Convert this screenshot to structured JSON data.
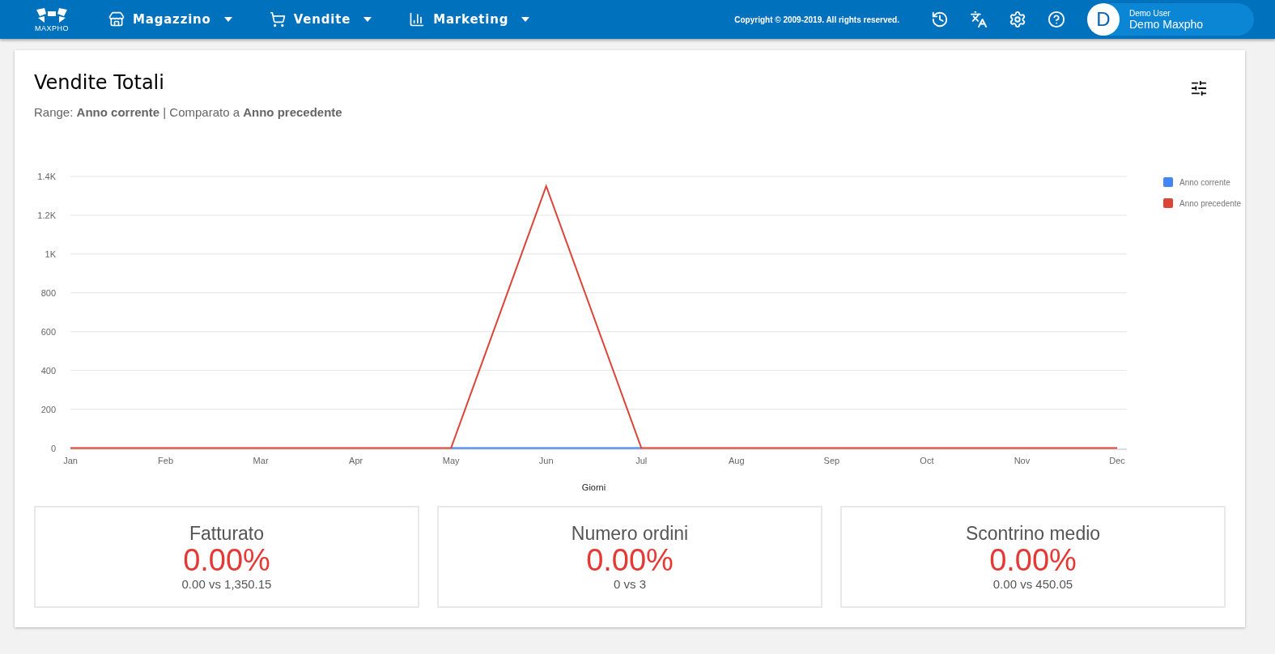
{
  "topbar": {
    "logo_text": "MAXPHO",
    "menus": [
      {
        "kind": "store",
        "label": "Magazzino"
      },
      {
        "kind": "cart",
        "label": "Vendite"
      },
      {
        "kind": "bars",
        "label": "Marketing"
      }
    ],
    "copyright": "Copyright © 2009-2019. All rights reserved.",
    "user": {
      "initial": "D",
      "role": "Demo User",
      "name": "Demo Maxpho"
    }
  },
  "report": {
    "title": "Vendite Totali",
    "subtitle": "Range: **Anno corrente** | Comparato a **Anno precedente**",
    "chart_data": {
      "type": "line",
      "xlabel": "Giorni",
      "categories": [
        "Jan",
        "Feb",
        "Mar",
        "Apr",
        "May",
        "Jun",
        "Jul",
        "Aug",
        "Sep",
        "Oct",
        "Nov",
        "Dec"
      ],
      "series": [
        {
          "name": "Anno corrente",
          "color": "#4285f4",
          "values": [
            null,
            null,
            null,
            null,
            0,
            0,
            0,
            null,
            null,
            null,
            null,
            null
          ]
        },
        {
          "name": "Anno precedente",
          "color": "#db4437",
          "values": [
            0,
            0,
            0,
            0,
            0,
            1350,
            0,
            0,
            0,
            0,
            0,
            0
          ]
        }
      ],
      "grid": true,
      "ylim": [
        0,
        1400
      ],
      "yticks": [
        0,
        200,
        400,
        600,
        800,
        {
          "value": 1000,
          "label": "1K"
        },
        {
          "value": 1200,
          "label": "1.2K"
        },
        {
          "value": 1400,
          "label": "1.4K"
        }
      ]
    },
    "stats": [
      {
        "label": "Fatturato",
        "value": "0.00%",
        "comparison": "0.00 vs 1,350.15"
      },
      {
        "label": "Numero ordini",
        "value": "0.00%",
        "comparison": "0 vs 3"
      },
      {
        "label": "Scontrino medio",
        "value": "0.00%",
        "comparison": "0.00 vs 450.05"
      }
    ]
  }
}
